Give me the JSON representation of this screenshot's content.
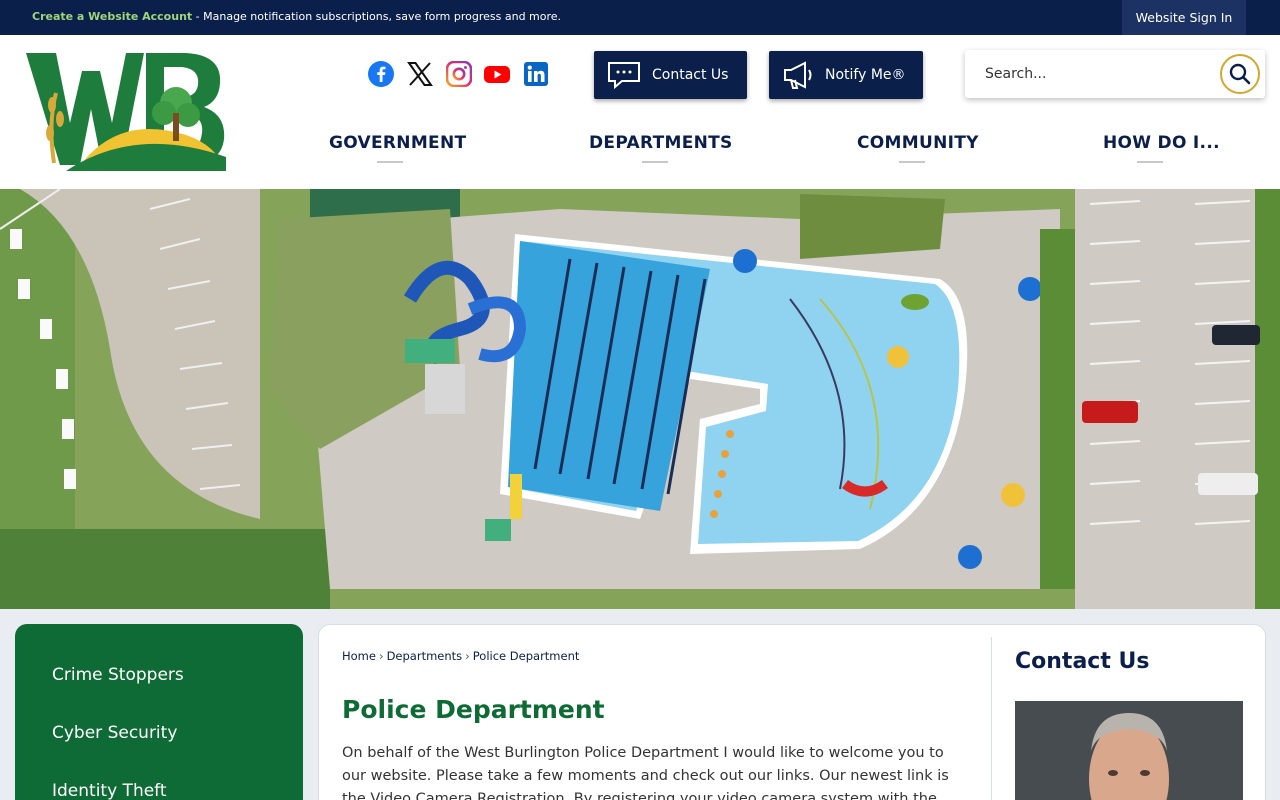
{
  "topbar": {
    "account_link": "Create a Website Account",
    "message": " - Manage notification subscriptions, save form progress and more.",
    "signin_label": "Website Sign In"
  },
  "logo": {
    "text": "WB"
  },
  "social": [
    "facebook-icon",
    "x-icon",
    "instagram-icon",
    "youtube-icon",
    "linkedin-icon"
  ],
  "buttons": {
    "contact_label": "Contact Us",
    "notify_label": "Notify Me®"
  },
  "search": {
    "placeholder": "Search..."
  },
  "nav": [
    "GOVERNMENT",
    "DEPARTMENTS",
    "COMMUNITY",
    "HOW DO I..."
  ],
  "sidebar": {
    "items": [
      "Crime Stoppers",
      "Cyber Security",
      "Identity Theft"
    ]
  },
  "breadcrumb": {
    "home": "Home",
    "separator": "›",
    "departments": "Departments",
    "current": "Police Department"
  },
  "main": {
    "title": "Police Department",
    "intro": "On behalf of the West Burlington Police Department I would like to welcome you to our website. Please take a few moments and check out our links. Our newest link is the Video Camera Registration. By registering your video camera system with the WBPD officers will"
  },
  "contact": {
    "title": "Contact Us"
  },
  "colors": {
    "navy": "#0b1f4b",
    "green": "#0f6b35",
    "accent": "#9fd47a",
    "gold": "#d4a72c"
  }
}
